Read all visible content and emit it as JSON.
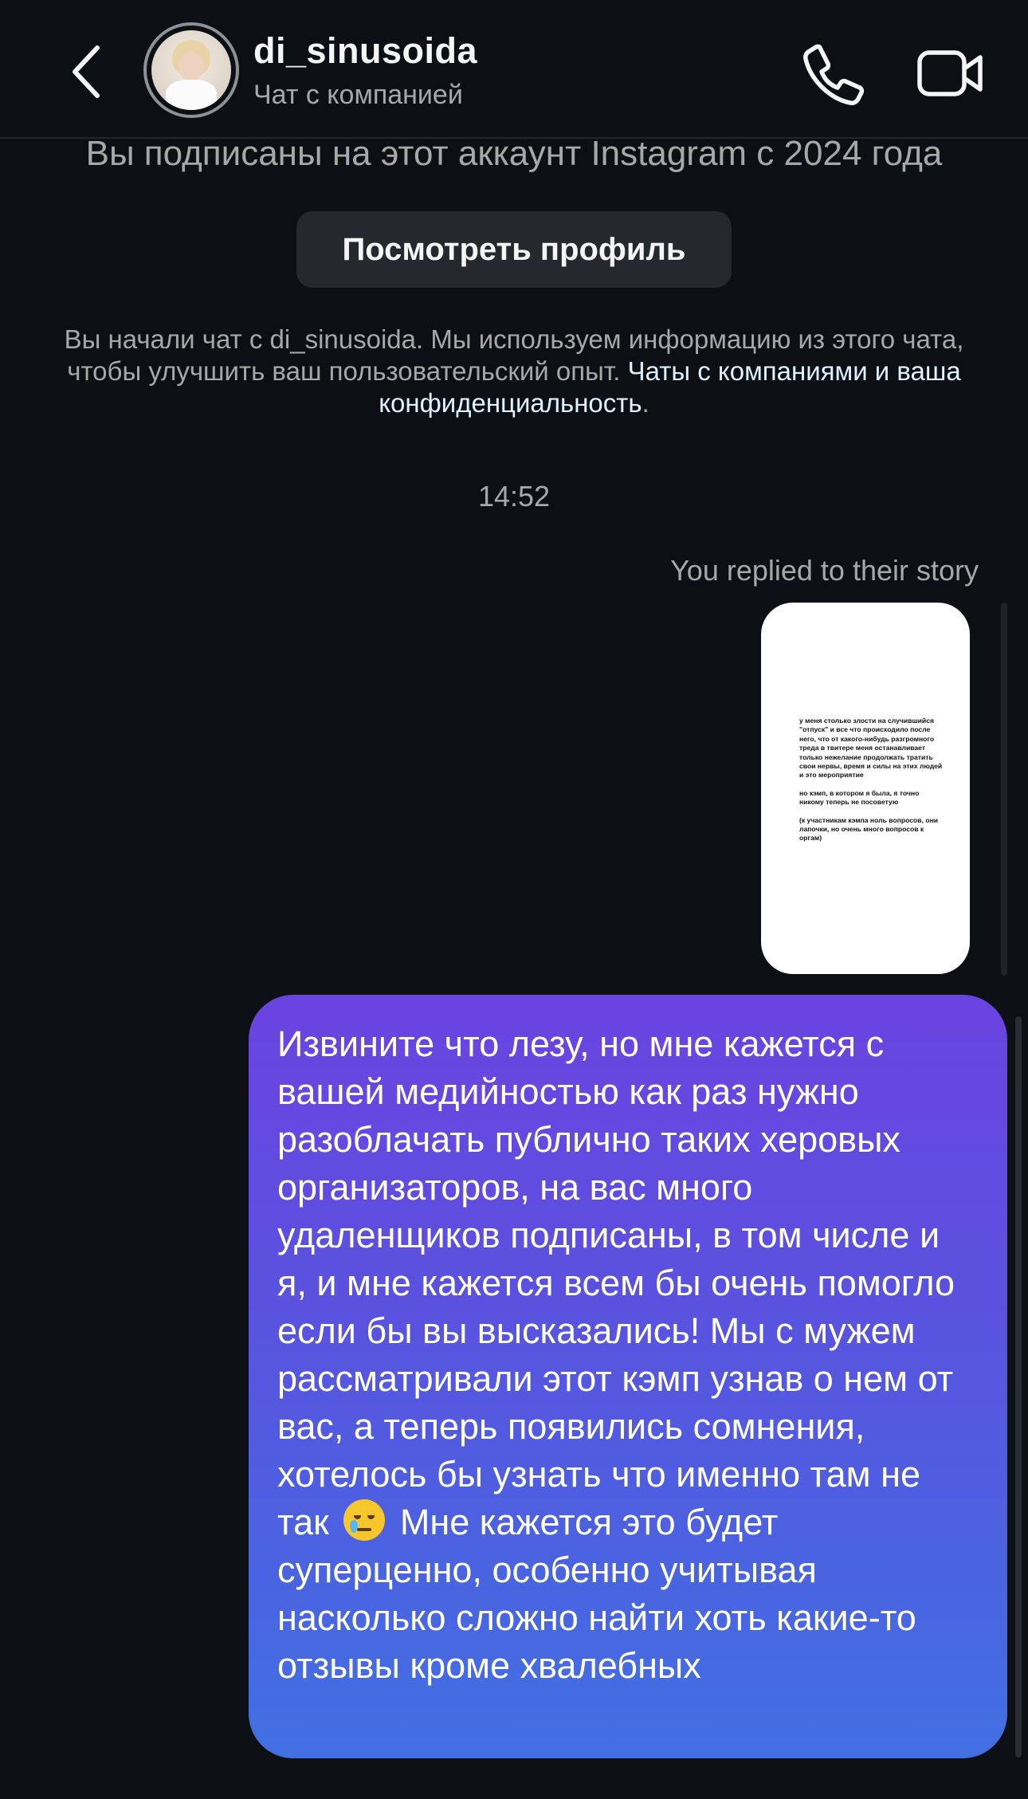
{
  "header": {
    "username": "di_sinusoida",
    "subtitle": "Чат с компанией",
    "icons": {
      "back": "chevron-left-icon",
      "call": "phone-icon",
      "video": "video-camera-icon"
    }
  },
  "profile_card": {
    "follow_note": "Вы подписаны на этот аккаунт Instagram с 2024 года",
    "view_profile_label": "Посмотреть профиль",
    "info_text": "Вы начали чат с di_sinusoida. Мы используем информацию из этого чата, чтобы улучшить ваш пользовательский опыт.",
    "info_link": "Чаты с компаниями и ваша конфиденциальность",
    "info_end": "."
  },
  "conversation": {
    "time": "14:52",
    "replied_label": "You replied to their story",
    "story_lines": [
      "у меня столько злости на случившийся \"отпуск\" и все что происходило после него, что от какого-нибудь разгромного треда в твитере меня останавливает только нежелание продолжать тратить свои нервы, время и силы на этих людей и это мероприятие",
      "но кэмп, в котором я была, я точно никому теперь не посоветую",
      "(к участникам кэмпа ноль вопросов, они лапочки, но очень много вопросов к оргам)"
    ],
    "message_before_emoji": "Извините что лезу, но мне кажется с вашей медийностью как раз нужно разоблачать публично таких херовых организаторов, на вас много удаленщиков подписаны, в том числе и я, и мне кажется всем бы очень помогло если бы вы высказались! Мы с мужем рассматривали этот кэмп узнав о нем от вас, а теперь появились сомнения, хотелось бы узнать что именно там не так",
    "message_emoji": "face-holding-back-tears-emoji",
    "message_after_emoji": "Мне кажется это будет суперценно, особенно учитывая насколько сложно найти хоть какие-то отзывы кроме хвалебных"
  },
  "colors": {
    "background": "#0c1014",
    "bubble_top": "#6b43e0",
    "bubble_bottom": "#4270e3",
    "secondary_text": "#a8a8a8",
    "link": "#e0f1ff"
  }
}
